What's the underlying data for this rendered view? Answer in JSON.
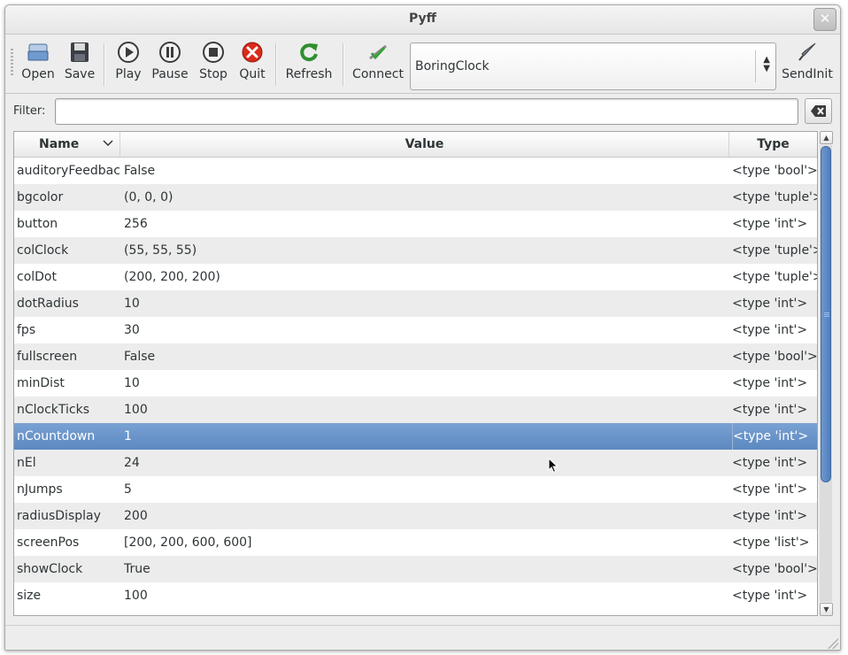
{
  "window": {
    "title": "Pyff",
    "close_glyph": "✕"
  },
  "toolbar": {
    "open_label": "Open",
    "save_label": "Save",
    "play_label": "Play",
    "pause_label": "Pause",
    "stop_label": "Stop",
    "quit_label": "Quit",
    "refresh_label": "Refresh",
    "connect_label": "Connect",
    "feedback_select": {
      "value": "BoringClock"
    },
    "sendinit_label": "SendInit"
  },
  "filter": {
    "label": "Filter:",
    "value": "",
    "placeholder": ""
  },
  "table": {
    "columns": {
      "name": "Name",
      "value": "Value",
      "type": "Type"
    },
    "rows": [
      {
        "name": "auditoryFeedback",
        "value": "False",
        "type": "<type 'bool'>"
      },
      {
        "name": "bgcolor",
        "value": "(0, 0, 0)",
        "type": "<type 'tuple'>"
      },
      {
        "name": "button",
        "value": "256",
        "type": "<type 'int'>"
      },
      {
        "name": "colClock",
        "value": "(55, 55, 55)",
        "type": "<type 'tuple'>"
      },
      {
        "name": "colDot",
        "value": "(200, 200, 200)",
        "type": "<type 'tuple'>"
      },
      {
        "name": "dotRadius",
        "value": "10",
        "type": "<type 'int'>"
      },
      {
        "name": "fps",
        "value": "30",
        "type": "<type 'int'>"
      },
      {
        "name": "fullscreen",
        "value": "False",
        "type": "<type 'bool'>"
      },
      {
        "name": "minDist",
        "value": "10",
        "type": "<type 'int'>"
      },
      {
        "name": "nClockTicks",
        "value": "100",
        "type": "<type 'int'>"
      },
      {
        "name": "nCountdown",
        "value": "1",
        "type": "<type 'int'>",
        "selected": true
      },
      {
        "name": "nEl",
        "value": "24",
        "type": "<type 'int'>"
      },
      {
        "name": "nJumps",
        "value": "5",
        "type": "<type 'int'>"
      },
      {
        "name": "radiusDisplay",
        "value": "200",
        "type": "<type 'int'>"
      },
      {
        "name": "screenPos",
        "value": "[200, 200, 600, 600]",
        "type": "<type 'list'>"
      },
      {
        "name": "showClock",
        "value": "True",
        "type": "<type 'bool'>"
      },
      {
        "name": "size",
        "value": "100",
        "type": "<type 'int'>"
      }
    ]
  },
  "colors": {
    "selection": "#5b88c0",
    "scroll_thumb": "#4f7fbd"
  }
}
